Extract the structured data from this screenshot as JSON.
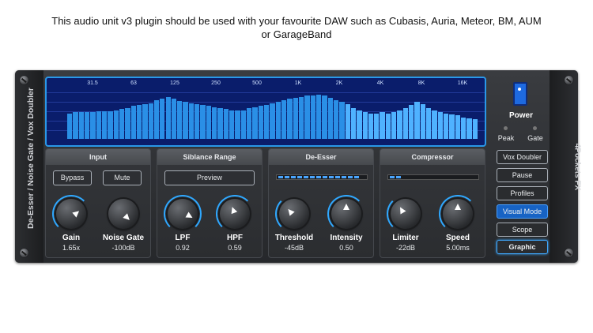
{
  "caption": {
    "line1": "This audio unit v3 plugin should be used with your favourite DAW such as Cubasis, Auria, Meteor, BM, AUM",
    "line2": "or GarageBand"
  },
  "plugin": {
    "left_title": "De-Esser / Noise Gate / Vox Doubler",
    "right_title": "4Pockets FX"
  },
  "analyzer": {
    "freq_labels": [
      "31.5",
      "63",
      "125",
      "250",
      "500",
      "1K",
      "2K",
      "4K",
      "8K",
      "16K"
    ],
    "bar_levels": [
      0.5,
      0.52,
      0.52,
      0.52,
      0.53,
      0.54,
      0.54,
      0.54,
      0.56,
      0.58,
      0.6,
      0.64,
      0.66,
      0.68,
      0.7,
      0.75,
      0.78,
      0.82,
      0.78,
      0.74,
      0.72,
      0.7,
      0.68,
      0.66,
      0.64,
      0.62,
      0.6,
      0.58,
      0.56,
      0.55,
      0.56,
      0.6,
      0.62,
      0.65,
      0.66,
      0.7,
      0.72,
      0.75,
      0.78,
      0.8,
      0.82,
      0.84,
      0.85,
      0.86,
      0.84,
      0.8,
      0.76,
      0.72,
      0.68,
      0.6,
      0.55,
      0.52,
      0.5,
      0.5,
      0.52,
      0.5,
      0.52,
      0.55,
      0.6,
      0.66,
      0.72,
      0.68,
      0.6,
      0.55,
      0.52,
      0.5,
      0.48,
      0.46,
      0.42,
      0.4,
      0.38
    ]
  },
  "panels": [
    {
      "title": "Input",
      "buttons": [
        "Bypass",
        "Mute"
      ],
      "knobs": [
        {
          "label": "Gain",
          "value": "1.65x",
          "level": 0.55
        },
        {
          "label": "Noise Gate",
          "value": "-100dB",
          "level": 0.05
        }
      ]
    },
    {
      "title": "Siblance Range",
      "buttons": [
        "Preview"
      ],
      "knobs": [
        {
          "label": "LPF",
          "value": "0.92",
          "level": 0.9
        },
        {
          "label": "HPF",
          "value": "0.59",
          "level": 0.55
        }
      ]
    },
    {
      "title": "De-Esser",
      "meter": 0.95,
      "knobs": [
        {
          "label": "Threshold",
          "value": "-45dB",
          "level": 0.2
        },
        {
          "label": "Intensity",
          "value": "0.50",
          "level": 0.5
        }
      ]
    },
    {
      "title": "Compressor",
      "meter": 0.12,
      "knobs": [
        {
          "label": "Limiter",
          "value": "-22dB",
          "level": 0.3
        },
        {
          "label": "Speed",
          "value": "5.00ms",
          "level": 0.5
        }
      ]
    }
  ],
  "controls": {
    "power_label": "Power",
    "peak_label": "Peak",
    "gate_label": "Gate",
    "buttons": [
      {
        "label": "Vox Doubler",
        "state": "normal"
      },
      {
        "label": "Pause",
        "state": "normal"
      },
      {
        "label": "Profiles",
        "state": "normal"
      },
      {
        "label": "Visual Mode",
        "state": "active"
      },
      {
        "label": "Scope",
        "state": "normal"
      },
      {
        "label": "Graphic",
        "state": "selected"
      }
    ]
  },
  "colors": {
    "accent": "#2fa8ff",
    "analyzer_bg": "#0a1d6b",
    "bar_blue": "#2a8fe6",
    "bar_light": "#4fb2ff"
  }
}
